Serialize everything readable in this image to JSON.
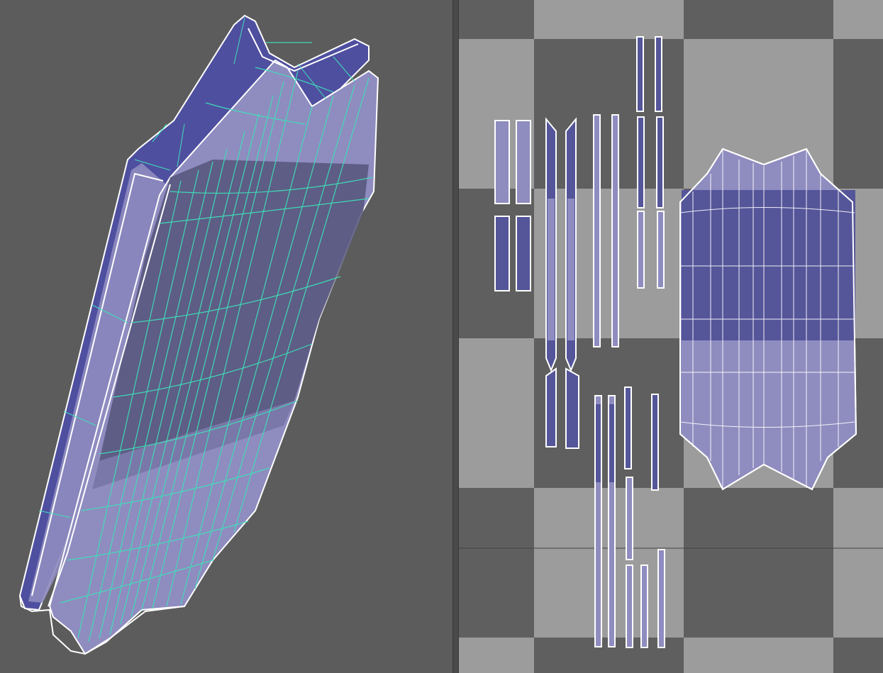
{
  "viewport": {
    "name": "3d-viewport",
    "background": "#5c5c5c",
    "mesh_face_color": "#4a4aa8",
    "mesh_face_light": "#8f8cc0",
    "wire_color": "#3fe0b8",
    "outline_color": "#ffffff"
  },
  "uv_editor": {
    "name": "uv-editor",
    "checker_light": "#9c9c9c",
    "checker_dark": "#5f5f5f",
    "uv_fill_dark": "#55559a",
    "uv_fill_light": "#8f8cc0",
    "uv_edge_color": "#ffffff"
  }
}
